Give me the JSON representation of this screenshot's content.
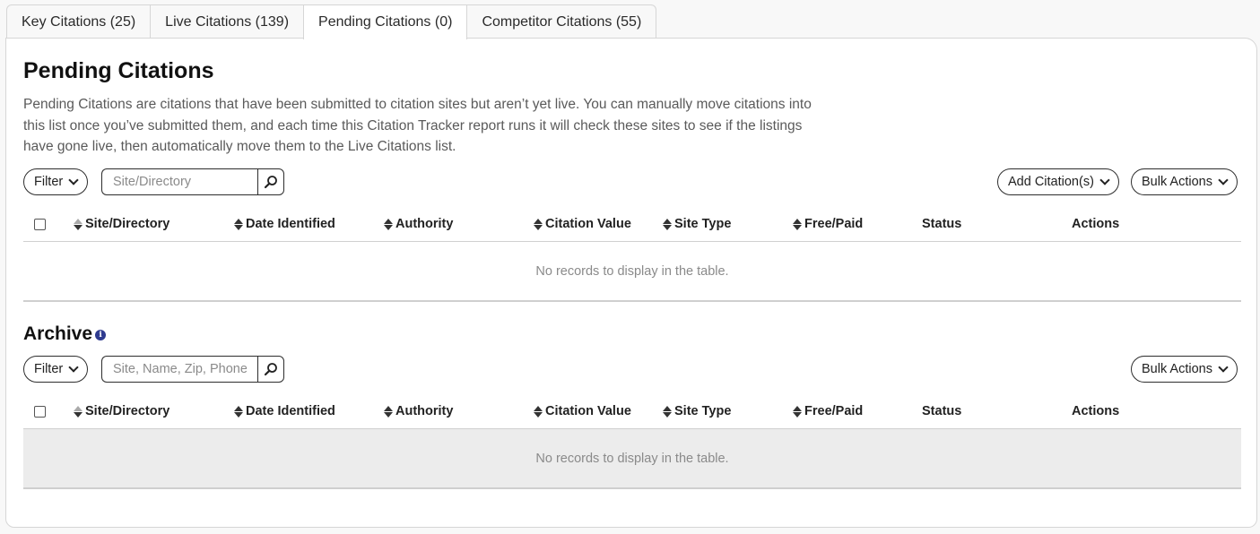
{
  "tabs": [
    {
      "label": "Key Citations (25)"
    },
    {
      "label": "Live Citations (139)"
    },
    {
      "label": "Pending Citations (0)",
      "active": true
    },
    {
      "label": "Competitor Citations (55)"
    }
  ],
  "pending": {
    "title": "Pending Citations",
    "description": "Pending Citations are citations that have been submitted to citation sites but aren’t yet live. You can manually move citations into this list once you’ve submitted them, and each time this Citation Tracker report runs it will check these sites to see if the listings have gone live, then automatically move them to the Live Citations list.",
    "filter_label": "Filter",
    "search_placeholder": "Site/Directory",
    "add_label": "Add Citation(s)",
    "bulk_label": "Bulk Actions",
    "columns": [
      "Site/Directory",
      "Date Identified",
      "Authority",
      "Citation Value",
      "Site Type",
      "Free/Paid",
      "Status",
      "Actions"
    ],
    "empty_text": "No records to display in the table."
  },
  "archive": {
    "title": "Archive",
    "info_icon": "info-icon",
    "filter_label": "Filter",
    "search_placeholder": "Site, Name, Zip, Phone",
    "bulk_label": "Bulk Actions",
    "columns": [
      "Site/Directory",
      "Date Identified",
      "Authority",
      "Citation Value",
      "Site Type",
      "Free/Paid",
      "Status",
      "Actions"
    ],
    "empty_text": "No records to display in the table."
  },
  "icons": {
    "search": "search-icon",
    "chevron": "chevron-down-icon",
    "sort": "sort-icon"
  }
}
